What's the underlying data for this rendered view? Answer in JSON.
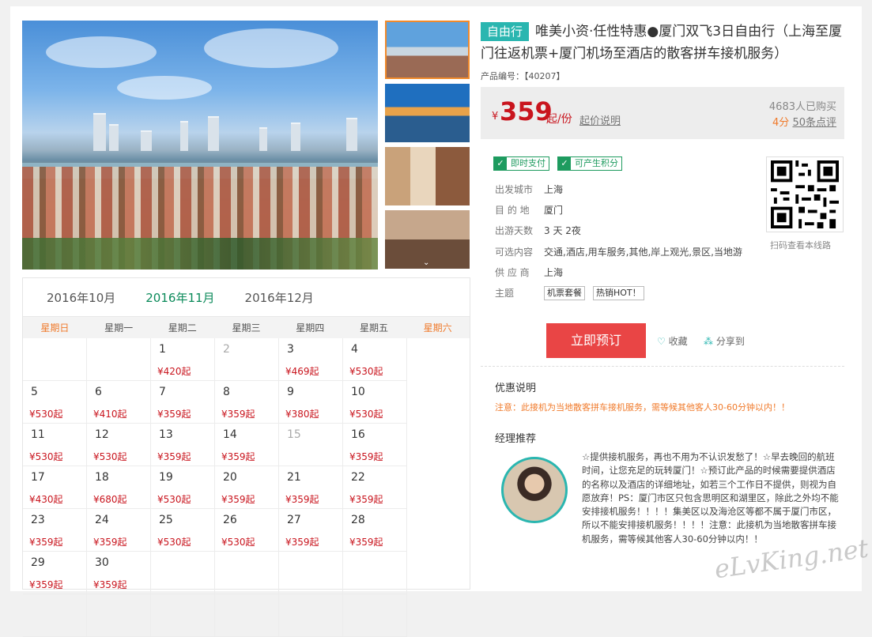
{
  "product": {
    "tag": "自由行",
    "title": "唯美小资·任性特惠●厦门双飞3日自由行（上海至厦门往返机票+厦门机场至酒店的散客拼车接机服务）",
    "code": "产品编号：【40207】"
  },
  "price": {
    "currency": "¥",
    "amount": "359",
    "unit": "起/份",
    "explain": "起价说明",
    "bought": "4683人已购买",
    "score": "4分",
    "reviews": "50条点评"
  },
  "badges": [
    "即时支付",
    "可产生积分"
  ],
  "props": [
    {
      "k": "出发城市",
      "v": "上海"
    },
    {
      "k": "目 的 地",
      "v": "厦门"
    },
    {
      "k": "出游天数",
      "v": "3 天 2夜"
    },
    {
      "k": "可选内容",
      "v": "交通,酒店,用车服务,其他,岸上观光,景区,当地游"
    },
    {
      "k": "供 应 商",
      "v": "上海"
    }
  ],
  "theme": {
    "k": "主题",
    "tags": [
      "机票套餐",
      "热销HOT！"
    ]
  },
  "qr_caption": "扫码查看本线路",
  "actions": {
    "book": "立即预订",
    "fav": "收藏",
    "share": "分享到"
  },
  "discount": {
    "title": "优惠说明",
    "note": "注意：此接机为当地散客拼车接机服务，需等候其他客人30-60分钟以内！！"
  },
  "manager": {
    "title": "经理推荐",
    "text": "☆提供接机服务，再也不用为不认识发愁了！☆早去晚回的航班时间，让您充足的玩转厦门！☆预订此产品的时候需要提供酒店的名称以及酒店的详细地址，如若三个工作日不提供，则视为自愿放弃！PS：厦门市区只包含思明区和湖里区，除此之外均不能安排接机服务！！！！集美区以及海沧区等都不属于厦门市区，所以不能安排接机服务！！！！注意：此接机为当地散客拼车接机服务，需等候其他客人30-60分钟以内！！"
  },
  "calendar": {
    "months": [
      "2016年10月",
      "2016年11月",
      "2016年12月"
    ],
    "active_month": 1,
    "weekdays": [
      "星期日",
      "星期一",
      "星期二",
      "星期三",
      "星期四",
      "星期五",
      "星期六"
    ],
    "cells": [
      {
        "d": "",
        "p": ""
      },
      {
        "d": "",
        "p": ""
      },
      {
        "d": "1",
        "p": "¥420起"
      },
      {
        "d": "2",
        "p": "",
        "dis": true
      },
      {
        "d": "3",
        "p": "¥469起"
      },
      {
        "d": "4",
        "p": "¥530起"
      },
      {
        "d": "5",
        "p": "¥530起"
      },
      {
        "d": "6",
        "p": "¥410起"
      },
      {
        "d": "7",
        "p": "¥359起"
      },
      {
        "d": "8",
        "p": "¥359起"
      },
      {
        "d": "9",
        "p": "¥380起"
      },
      {
        "d": "10",
        "p": "¥530起"
      },
      {
        "d": "11",
        "p": "¥530起"
      },
      {
        "d": "12",
        "p": "¥530起"
      },
      {
        "d": "13",
        "p": "¥359起"
      },
      {
        "d": "14",
        "p": "¥359起"
      },
      {
        "d": "15",
        "p": "",
        "dis": true
      },
      {
        "d": "16",
        "p": "¥359起"
      },
      {
        "d": "17",
        "p": "¥430起"
      },
      {
        "d": "18",
        "p": "¥680起"
      },
      {
        "d": "19",
        "p": "¥530起"
      },
      {
        "d": "20",
        "p": "¥359起"
      },
      {
        "d": "21",
        "p": "¥359起"
      },
      {
        "d": "22",
        "p": "¥359起"
      },
      {
        "d": "23",
        "p": "¥359起"
      },
      {
        "d": "24",
        "p": "¥359起"
      },
      {
        "d": "25",
        "p": "¥530起"
      },
      {
        "d": "26",
        "p": "¥530起"
      },
      {
        "d": "27",
        "p": "¥359起"
      },
      {
        "d": "28",
        "p": "¥359起"
      },
      {
        "d": "29",
        "p": "¥359起"
      },
      {
        "d": "30",
        "p": "¥359起"
      },
      {
        "d": "",
        "p": ""
      },
      {
        "d": "",
        "p": ""
      },
      {
        "d": "",
        "p": ""
      },
      {
        "d": "",
        "p": ""
      },
      {
        "d": "",
        "p": ""
      },
      {
        "d": "",
        "p": ""
      },
      {
        "d": "",
        "p": ""
      },
      {
        "d": "",
        "p": ""
      },
      {
        "d": "",
        "p": ""
      },
      {
        "d": "",
        "p": ""
      }
    ]
  },
  "watermark": "eLvKing.net",
  "colors": {
    "accent": "#2ab6b0",
    "price": "#c9151e",
    "book": "#e94545",
    "green": "#1e9b5f",
    "orange": "#f07a2b"
  }
}
